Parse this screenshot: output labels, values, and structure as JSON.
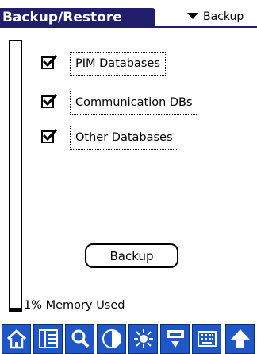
{
  "header": {
    "title": "Backup/Restore",
    "mode_picker_label": "Backup",
    "accent_color": "#211f6b"
  },
  "memory": {
    "used_fraction": 0.01,
    "label": "1% Memory Used"
  },
  "options": [
    {
      "label": "PIM Databases",
      "checked": true
    },
    {
      "label": "Communication DBs",
      "checked": true
    },
    {
      "label": "Other Databases",
      "checked": true
    }
  ],
  "actions": {
    "backup_label": "Backup"
  },
  "toolbar": {
    "color": "#1f57c8",
    "icons": [
      "home-icon",
      "application-list-icon",
      "search-icon",
      "contrast-icon",
      "brightness-icon",
      "sync-icon",
      "keyboard-icon",
      "up-arrow-icon"
    ]
  }
}
